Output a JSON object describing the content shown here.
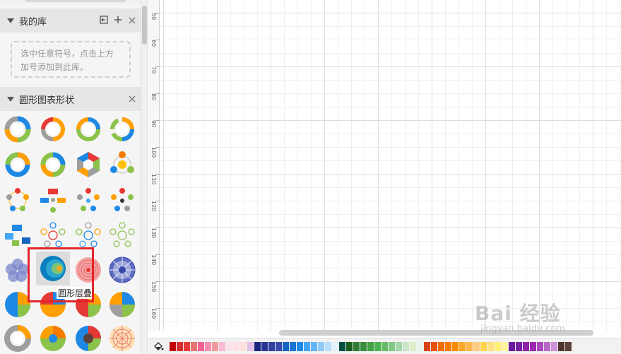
{
  "library": {
    "title": "我的库",
    "empty_hint": "选中任意符号，点击上方加号添加到此库。",
    "icons": [
      "import-icon",
      "plus-icon",
      "close-icon"
    ]
  },
  "shapes_section": {
    "title": "圆形图表形状",
    "tooltip": "圆形层叠",
    "icons": [
      "close-icon"
    ]
  },
  "ruler": {
    "labels": [
      "50",
      "60",
      "70",
      "80",
      "90",
      "100",
      "110",
      "120",
      "130",
      "140",
      "150",
      "160"
    ]
  },
  "colors": {
    "accent_highlight": "#e3242b",
    "swatches": [
      "#c00000",
      "#d32f2f",
      "#e53935",
      "#e57373",
      "#f06292",
      "#f48fb1",
      "#ef9a9a",
      "#f8bbd0",
      "#fce4ec",
      "#ffe0e6",
      "#fde0dc",
      "#e1bee7",
      "#1a237e",
      "#283593",
      "#303f9f",
      "#3949ab",
      "#1565c0",
      "#1976d2",
      "#1e88e5",
      "#42a5f5",
      "#64b5f6",
      "#90caf9",
      "#bbdefb",
      "#e3f2fd",
      "#004d40",
      "#1b5e20",
      "#2e7d32",
      "#388e3c",
      "#43a047",
      "#4caf50",
      "#66bb6a",
      "#81c784",
      "#a5d6a7",
      "#c8e6c9",
      "#dcedc8",
      "#e8f5e9",
      "#d84315",
      "#e65100",
      "#ef6c00",
      "#f57c00",
      "#fb8c00",
      "#ffa726",
      "#ffb74d",
      "#ffcc80",
      "#ffd54f",
      "#ffe082",
      "#fff176",
      "#fff59d",
      "#6a1b9a",
      "#7b1fa2",
      "#8e24aa",
      "#9c27b0",
      "#ab47bc",
      "#ba68c8",
      "#ce93d8",
      "#4e342e",
      "#5d4037"
    ]
  },
  "watermark": {
    "brand": "Bai 经验",
    "url": "jingyan.baidu.com"
  }
}
